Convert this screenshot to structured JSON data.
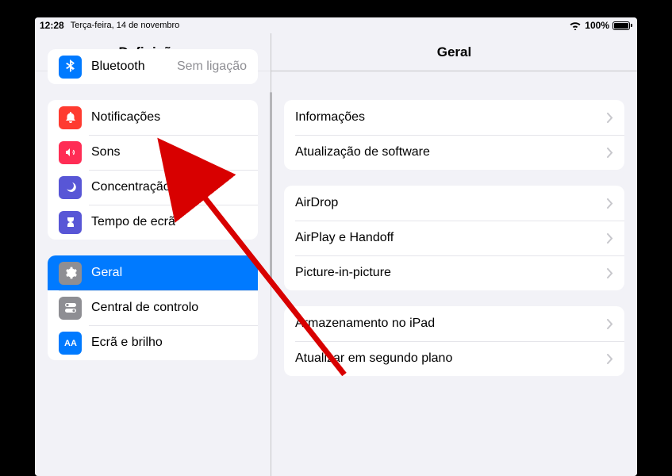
{
  "status": {
    "time": "12:28",
    "date": "Terça-feira, 14 de novembro",
    "battery_pct": "100%"
  },
  "sidebar": {
    "title": "Definições",
    "groups": [
      {
        "rows": [
          {
            "key": "bluetooth",
            "label": "Bluetooth",
            "value": "Sem ligação",
            "icon": "bluetooth",
            "color": "#007aff"
          }
        ]
      },
      {
        "rows": [
          {
            "key": "notifications",
            "label": "Notificações",
            "icon": "bell",
            "color": "#ff3b30"
          },
          {
            "key": "sounds",
            "label": "Sons",
            "icon": "speaker",
            "color": "#ff2d55"
          },
          {
            "key": "focus",
            "label": "Concentração",
            "icon": "moon",
            "color": "#5856d6"
          },
          {
            "key": "screentime",
            "label": "Tempo de ecrã",
            "icon": "hourglass",
            "color": "#5856d6"
          }
        ]
      },
      {
        "rows": [
          {
            "key": "general",
            "label": "Geral",
            "icon": "gear",
            "color": "#8e8e93",
            "selected": true
          },
          {
            "key": "controlcenter",
            "label": "Central de controlo",
            "icon": "toggles",
            "color": "#8e8e93"
          },
          {
            "key": "display",
            "label": "Ecrã e brilho",
            "icon": "aa",
            "color": "#007aff"
          }
        ]
      }
    ]
  },
  "main": {
    "title": "Geral",
    "groups": [
      {
        "rows": [
          {
            "key": "info",
            "label": "Informações"
          },
          {
            "key": "softwareupdate",
            "label": "Atualização de software"
          }
        ]
      },
      {
        "rows": [
          {
            "key": "airdrop",
            "label": "AirDrop"
          },
          {
            "key": "airplay",
            "label": "AirPlay e Handoff"
          },
          {
            "key": "pip",
            "label": "Picture-in-picture"
          }
        ]
      },
      {
        "rows": [
          {
            "key": "storage",
            "label": "Armazenamento no iPad"
          },
          {
            "key": "bgrefresh",
            "label": "Atualizar em segundo plano"
          }
        ]
      }
    ]
  }
}
